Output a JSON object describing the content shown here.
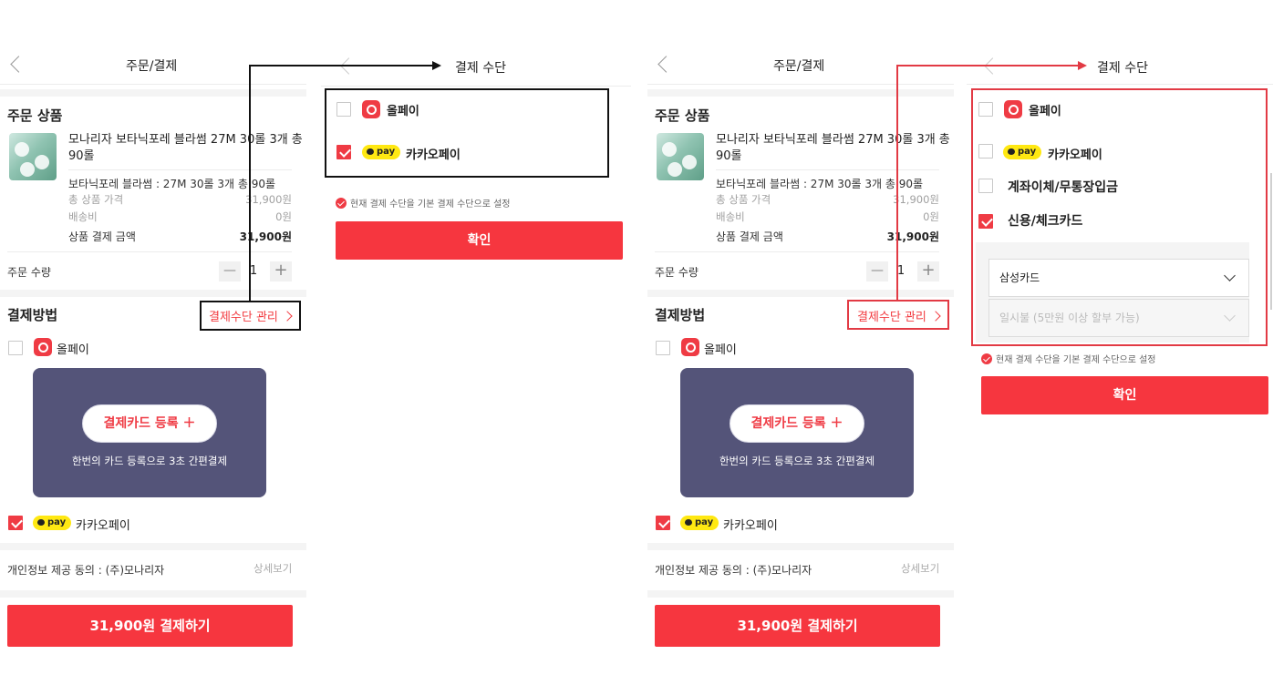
{
  "order_screen": {
    "title": "주문/결제",
    "product_section_title": "주문 상품",
    "product_name": "모나리자 보타닉포레 블라썸 27M 30롤 3개 총 90롤",
    "product_option": "보타닉포레 블라썸 : 27M 30롤 3개 총 90롤",
    "total_price_label": "총 상품 가격",
    "total_price_value": "31,900원",
    "shipping_label": "배송비",
    "shipping_value": "0원",
    "payment_amount_label": "상품 결제 금액",
    "payment_amount_value": "31,900원",
    "quantity_label": "주문 수량",
    "quantity_value": "1",
    "minus": "—",
    "plus": "+",
    "payment_method_title": "결제방법",
    "manage_link": "결제수단 관리",
    "olpay_label": "올페이",
    "card_register_label": "결제카드 등록 ＋",
    "card_register_caption": "한번의 카드 등록으로 3초 간편결제",
    "kakao_badge": "pay",
    "kakao_label": "카카오페이",
    "consent_label": "개인정보 제공 동의 : (주)모나리자",
    "consent_detail": "상세보기",
    "pay_button": "31,900원 결제하기"
  },
  "method_screen_a": {
    "title": "결제 수단",
    "olpay_label": "올페이",
    "kakao_badge": "pay",
    "kakao_label": "카카오페이",
    "default_note": "현재 결제 수단을 기본 결제 수단으로 설정",
    "confirm_button": "확인"
  },
  "method_screen_b": {
    "title": "결제 수단",
    "olpay_label": "올페이",
    "kakao_badge": "pay",
    "kakao_label": "카카오페이",
    "bank_label": "계좌이체/무통장입금",
    "card_label": "신용/체크카드",
    "card_company": "삼성카드",
    "installment": "일시불 (5만원 이상 할부 가능)",
    "default_note": "현재 결제 수단을 기본 결제 수단으로 설정",
    "confirm_button": "확인"
  },
  "colors": {
    "accent_red": "#f6363f",
    "card_panel": "#545479",
    "kakao_yellow": "#ffe812"
  }
}
